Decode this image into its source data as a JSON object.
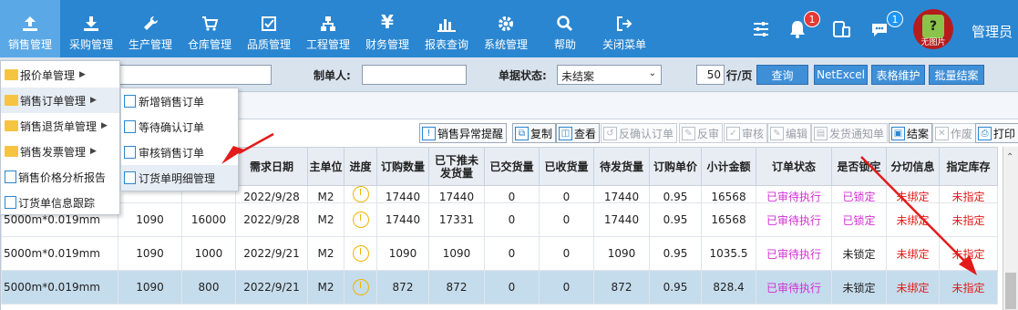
{
  "topnav": {
    "items": [
      {
        "label": "销售管理",
        "icon": "upload-icon"
      },
      {
        "label": "采购管理",
        "icon": "download-icon"
      },
      {
        "label": "生产管理",
        "icon": "wrench-icon"
      },
      {
        "label": "仓库管理",
        "icon": "cart-icon"
      },
      {
        "label": "品质管理",
        "icon": "checkbox-icon"
      },
      {
        "label": "工程管理",
        "icon": "org-chart-icon"
      },
      {
        "label": "财务管理",
        "icon": "yen-icon"
      },
      {
        "label": "报表查询",
        "icon": "bar-chart-icon"
      },
      {
        "label": "系统管理",
        "icon": "gear-icon"
      },
      {
        "label": "帮助",
        "icon": "search-icon"
      },
      {
        "label": "关闭菜单",
        "icon": "exit-icon"
      }
    ],
    "notification_count": "1",
    "message_count": "1",
    "avatar_text": "无图片",
    "user_label": "管理员"
  },
  "filters": {
    "creator_label": "制单人:",
    "status_label": "单据状态:",
    "status_value": "未结案",
    "rows_value": "50",
    "rows_unit": "行/页",
    "query_button": "查询",
    "netexcel_button": "NetExcel",
    "table_maint_button": "表格维护",
    "batch_close_button": "批量结案"
  },
  "toolbar": {
    "buttons": [
      {
        "label": "销售异常提醒",
        "enabled": true
      },
      {
        "label": "复制",
        "enabled": true
      },
      {
        "label": "查看",
        "enabled": true
      },
      {
        "label": "反确认订单",
        "enabled": false
      },
      {
        "label": "反审",
        "enabled": false
      },
      {
        "label": "审核",
        "enabled": false
      },
      {
        "label": "编辑",
        "enabled": false
      },
      {
        "label": "发货通知单",
        "enabled": false
      },
      {
        "label": "结案",
        "enabled": true
      },
      {
        "label": "作废",
        "enabled": false
      },
      {
        "label": "打印",
        "enabled": true
      }
    ]
  },
  "menu": {
    "items": [
      {
        "label": "报价单管理",
        "type": "folder",
        "submenu": true
      },
      {
        "label": "销售订单管理",
        "type": "folder",
        "submenu": true
      },
      {
        "label": "销售退货单管理",
        "type": "folder",
        "submenu": true
      },
      {
        "label": "销售发票管理",
        "type": "folder",
        "submenu": true
      },
      {
        "label": "销售价格分析报告",
        "type": "doc",
        "submenu": false
      },
      {
        "label": "订货单信息跟踪",
        "type": "doc",
        "submenu": false
      }
    ],
    "submenu": [
      {
        "label": "新增销售订单"
      },
      {
        "label": "等待确认订单"
      },
      {
        "label": "审核销售订单"
      },
      {
        "label": "订货单明细管理"
      }
    ]
  },
  "table": {
    "headers": [
      "需求日期",
      "主单位",
      "进度",
      "订购数量",
      "已下推未发货量",
      "已交货量",
      "已收货量",
      "待发货量",
      "订购单价",
      "小计金额",
      "订单状态",
      "是否锁定",
      "分切信息",
      "指定库存"
    ],
    "rows": [
      {
        "spec": "",
        "c1": "",
        "c2": "",
        "date": "2022/9/28",
        "unit": "M2",
        "qty": "17440",
        "pushed": "17440",
        "delivered": "0",
        "received": "0",
        "pending": "17440",
        "price": "0.95",
        "amount": "16568",
        "status": "已审待执行",
        "locked": "已锁定",
        "split": "未绑定",
        "stock": "未指定"
      },
      {
        "spec": "5000m*0.019mm",
        "c1": "1090",
        "c2": "16000",
        "date": "2022/9/28",
        "unit": "M2",
        "qty": "17440",
        "pushed": "17331",
        "delivered": "0",
        "received": "0",
        "pending": "17440",
        "price": "0.95",
        "amount": "16568",
        "status": "已审待执行",
        "locked": "已锁定",
        "split": "未绑定",
        "stock": "未指定"
      },
      {
        "spec": "5000m*0.019mm",
        "c1": "1090",
        "c2": "1000",
        "date": "2022/9/21",
        "unit": "M2",
        "qty": "1090",
        "pushed": "1090",
        "delivered": "0",
        "received": "0",
        "pending": "1090",
        "price": "0.95",
        "amount": "1035.5",
        "status": "已审待执行",
        "locked": "未锁定",
        "split": "未绑定",
        "stock": "未指定"
      },
      {
        "spec": "5000m*0.019mm",
        "c1": "1090",
        "c2": "800",
        "date": "2022/9/21",
        "unit": "M2",
        "qty": "872",
        "pushed": "872",
        "delivered": "0",
        "received": "0",
        "pending": "872",
        "price": "0.95",
        "amount": "828.4",
        "status": "已审待执行",
        "locked": "未锁定",
        "split": "未绑定",
        "stock": "未指定"
      }
    ]
  },
  "colors": {
    "topbar": "#2a86d1",
    "active_nav": "#5aa8e6",
    "selected_row": "#c5dcec",
    "annotation_arrow": "#e31b1b",
    "status_magenta": "#d32ed6"
  }
}
